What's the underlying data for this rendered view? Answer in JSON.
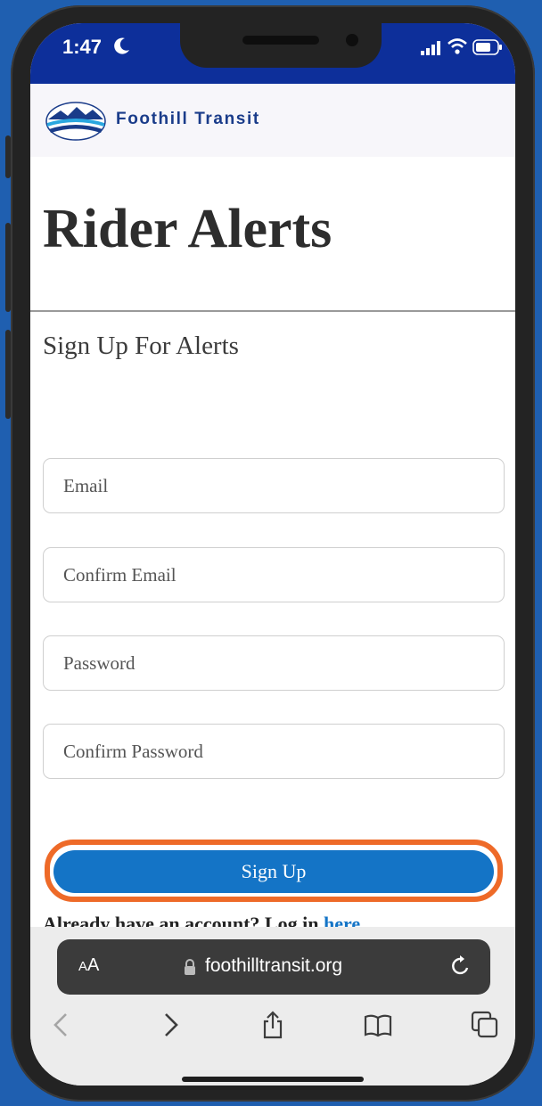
{
  "status_bar": {
    "time": "1:47"
  },
  "header": {
    "logo_text": "Foothill Transit"
  },
  "page": {
    "title": "Rider Alerts",
    "subtitle": "Sign Up For Alerts"
  },
  "form": {
    "email_placeholder": "Email",
    "confirm_email_placeholder": "Confirm Email",
    "password_placeholder": "Password",
    "confirm_password_placeholder": "Confirm Password",
    "signup_label": "Sign Up",
    "login_prompt": "Already have an account? Log in ",
    "login_link": "here"
  },
  "browser": {
    "aa_big": "A",
    "aa_small": "A",
    "url": "foothilltransit.org"
  },
  "colors": {
    "status_bar": "#0d2f9a",
    "brand_blue": "#1474c6",
    "highlight_orange": "#ee6a28",
    "background": "#1f5fb0"
  },
  "icons": [
    "moon-icon",
    "cellular-signal-icon",
    "wifi-icon",
    "battery-icon",
    "lock-icon",
    "reload-icon",
    "back-icon",
    "forward-icon",
    "share-icon",
    "bookmarks-icon",
    "tabs-icon"
  ]
}
